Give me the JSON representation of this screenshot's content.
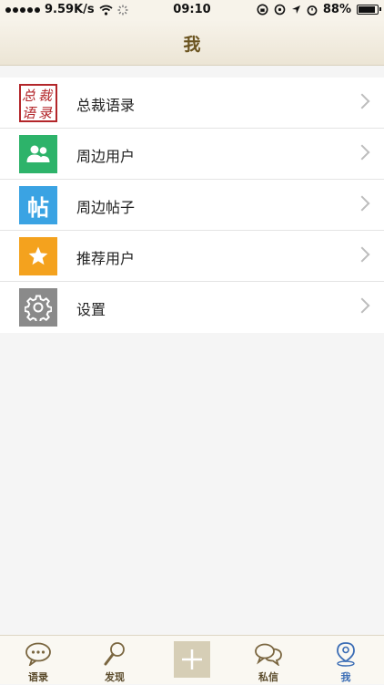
{
  "status_bar": {
    "network_speed": "9.59K/s",
    "time": "09:10",
    "battery_percent": "88%",
    "battery_level": 0.88
  },
  "nav": {
    "title": "我"
  },
  "menu": {
    "items": [
      {
        "label": "总裁语录",
        "icon": "quote-seal-icon",
        "color": "#b3262a",
        "seal_text": "总裁语录"
      },
      {
        "label": "周边用户",
        "icon": "nearby-users-icon",
        "color": "#2db36a"
      },
      {
        "label": "周边帖子",
        "icon": "nearby-posts-icon",
        "color": "#3aa3e3",
        "glyph": "帖"
      },
      {
        "label": "推荐用户",
        "icon": "star-icon",
        "color": "#f4a21e"
      },
      {
        "label": "设置",
        "icon": "gear-icon",
        "color": "#8a8a8a"
      }
    ]
  },
  "tab_bar": {
    "tabs": [
      {
        "label": "语录",
        "icon": "chat-bubble-icon"
      },
      {
        "label": "发现",
        "icon": "magnifier-icon"
      },
      {
        "label": "",
        "icon": "plus-icon"
      },
      {
        "label": "私信",
        "icon": "messages-icon"
      },
      {
        "label": "我",
        "icon": "profile-pin-icon",
        "active": true
      }
    ]
  },
  "colors": {
    "accent": "#3b6db5",
    "nav_title": "#6b5420",
    "tab_label": "#5a4a2a"
  }
}
